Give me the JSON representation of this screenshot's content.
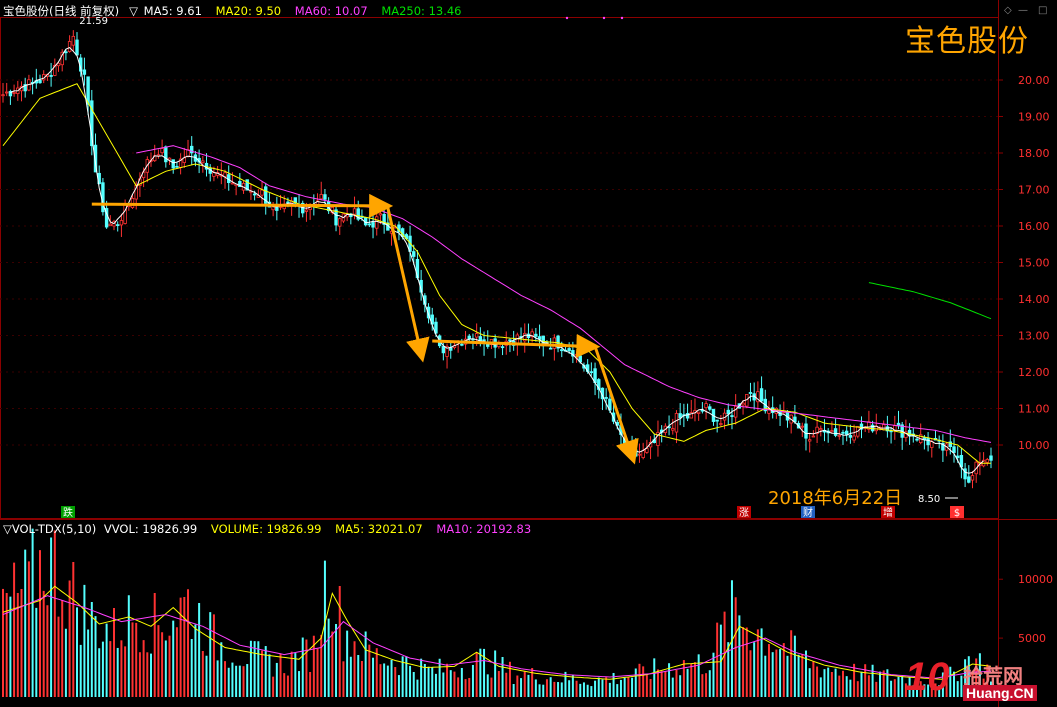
{
  "header": {
    "stock_name": "宝色股份(日线 前复权)",
    "ma_labels": [
      {
        "text": "MA5: 9.61",
        "color": "#ffffff"
      },
      {
        "text": "MA20: 9.50",
        "color": "#ffff00"
      },
      {
        "text": "MA60: 10.07",
        "color": "#ff40ff"
      },
      {
        "text": "MA250: 13.46",
        "color": "#00e000"
      }
    ],
    "title_overlay": "宝色股份",
    "date_annotation": "2018年6月22日"
  },
  "volume_header": {
    "indicator": "▽VOL-TDX(5,10)",
    "labels": [
      {
        "text": "VVOL: 19826.99",
        "color": "#ffffff"
      },
      {
        "text": "VOLUME: 19826.99",
        "color": "#ffff00"
      },
      {
        "text": "MA5: 32021.07",
        "color": "#ffff00"
      },
      {
        "text": "MA10: 20192.83",
        "color": "#ff40ff"
      }
    ]
  },
  "markers": {
    "high_label": "21.59",
    "low_label": "8.50",
    "event_badges": [
      {
        "text": "跌",
        "color": "#00a000"
      },
      {
        "text": "涨",
        "color": "#c00000"
      },
      {
        "text": "财",
        "color": "#2060c0"
      },
      {
        "text": "增",
        "color": "#c00000"
      },
      {
        "text": "$",
        "color": "#ff3030"
      }
    ]
  },
  "logo": {
    "brand": "10",
    "cn": "拾荒网",
    "url": "Huang.CN"
  },
  "colors": {
    "up": "#ff3232",
    "down": "#54ffff",
    "ma5": "#ffffff",
    "ma20": "#ffff00",
    "ma60": "#ff40ff",
    "ma250": "#00e000",
    "arrow": "#ffa500",
    "grid": "#8b0000"
  },
  "chart_data": [
    {
      "type": "candlestick",
      "title": "宝色股份(日线 前复权)",
      "y_ticks": [
        "20.00",
        "19.00",
        "18.00",
        "17.00",
        "16.00",
        "15.00",
        "14.00",
        "13.00",
        "12.00",
        "11.00",
        "10.00"
      ],
      "ylim": [
        8.2,
        21.9
      ],
      "close_path": [
        [
          0,
          19.6
        ],
        [
          4,
          19.8
        ],
        [
          8,
          19.9
        ],
        [
          12,
          20.1
        ],
        [
          16,
          20.7
        ],
        [
          19,
          21.2
        ],
        [
          22,
          20.0
        ],
        [
          25,
          17.5
        ],
        [
          28,
          16.0
        ],
        [
          31,
          16.1
        ],
        [
          34,
          16.6
        ],
        [
          38,
          17.6
        ],
        [
          42,
          18.1
        ],
        [
          46,
          17.6
        ],
        [
          50,
          18.0
        ],
        [
          54,
          17.8
        ],
        [
          58,
          17.4
        ],
        [
          62,
          17.2
        ],
        [
          66,
          17.0
        ],
        [
          70,
          16.9
        ],
        [
          74,
          16.3
        ],
        [
          78,
          16.6
        ],
        [
          82,
          16.5
        ],
        [
          86,
          16.8
        ],
        [
          90,
          16.2
        ],
        [
          94,
          16.4
        ],
        [
          98,
          16.0
        ],
        [
          102,
          16.2
        ],
        [
          106,
          15.9
        ],
        [
          110,
          15.4
        ],
        [
          114,
          14.0
        ],
        [
          118,
          12.6
        ],
        [
          122,
          12.8
        ],
        [
          126,
          13.0
        ],
        [
          130,
          12.9
        ],
        [
          134,
          12.8
        ],
        [
          138,
          12.9
        ],
        [
          142,
          13.0
        ],
        [
          146,
          12.8
        ],
        [
          150,
          12.8
        ],
        [
          154,
          12.6
        ],
        [
          158,
          12.0
        ],
        [
          162,
          11.4
        ],
        [
          166,
          10.4
        ],
        [
          170,
          9.7
        ],
        [
          174,
          9.8
        ],
        [
          178,
          10.3
        ],
        [
          182,
          10.7
        ],
        [
          186,
          10.8
        ],
        [
          190,
          11.0
        ],
        [
          194,
          10.6
        ],
        [
          198,
          11.0
        ],
        [
          202,
          11.5
        ],
        [
          206,
          11.1
        ],
        [
          210,
          10.9
        ],
        [
          214,
          10.6
        ],
        [
          218,
          10.2
        ],
        [
          222,
          10.5
        ],
        [
          226,
          10.3
        ],
        [
          230,
          10.4
        ],
        [
          234,
          10.5
        ],
        [
          238,
          10.6
        ],
        [
          242,
          10.4
        ],
        [
          246,
          10.3
        ],
        [
          250,
          10.1
        ],
        [
          254,
          9.9
        ],
        [
          258,
          9.8
        ],
        [
          261,
          8.9
        ],
        [
          264,
          9.6
        ],
        [
          267,
          9.7
        ]
      ],
      "ma_series": [
        {
          "name": "MA20",
          "key": "ma20",
          "points": [
            [
              0,
              18.2
            ],
            [
              10,
              19.5
            ],
            [
              20,
              19.9
            ],
            [
              28,
              18.5
            ],
            [
              36,
              17.1
            ],
            [
              44,
              17.5
            ],
            [
              52,
              17.7
            ],
            [
              60,
              17.5
            ],
            [
              70,
              17.0
            ],
            [
              80,
              16.6
            ],
            [
              90,
              16.4
            ],
            [
              100,
              16.2
            ],
            [
              106,
              16.0
            ],
            [
              112,
              15.3
            ],
            [
              118,
              14.1
            ],
            [
              124,
              13.3
            ],
            [
              130,
              13.0
            ],
            [
              140,
              12.9
            ],
            [
              150,
              12.8
            ],
            [
              158,
              12.6
            ],
            [
              164,
              12.0
            ],
            [
              170,
              11.0
            ],
            [
              176,
              10.3
            ],
            [
              184,
              10.1
            ],
            [
              190,
              10.4
            ],
            [
              198,
              10.6
            ],
            [
              206,
              11.0
            ],
            [
              214,
              10.9
            ],
            [
              222,
              10.6
            ],
            [
              230,
              10.5
            ],
            [
              240,
              10.4
            ],
            [
              250,
              10.2
            ],
            [
              258,
              10.0
            ],
            [
              264,
              9.5
            ],
            [
              267,
              9.5
            ]
          ]
        },
        {
          "name": "MA60",
          "key": "ma60",
          "points": [
            [
              36,
              18.0
            ],
            [
              46,
              18.2
            ],
            [
              56,
              17.9
            ],
            [
              64,
              17.6
            ],
            [
              72,
              17.1
            ],
            [
              82,
              16.8
            ],
            [
              92,
              16.6
            ],
            [
              100,
              16.5
            ],
            [
              108,
              16.2
            ],
            [
              116,
              15.7
            ],
            [
              124,
              15.1
            ],
            [
              132,
              14.6
            ],
            [
              140,
              14.1
            ],
            [
              148,
              13.7
            ],
            [
              156,
              13.2
            ],
            [
              162,
              12.7
            ],
            [
              168,
              12.2
            ],
            [
              174,
              11.9
            ],
            [
              180,
              11.6
            ],
            [
              188,
              11.3
            ],
            [
              196,
              11.1
            ],
            [
              204,
              11.0
            ],
            [
              212,
              10.9
            ],
            [
              220,
              10.8
            ],
            [
              228,
              10.7
            ],
            [
              236,
              10.6
            ],
            [
              244,
              10.5
            ],
            [
              252,
              10.4
            ],
            [
              260,
              10.2
            ],
            [
              267,
              10.07
            ]
          ]
        },
        {
          "name": "MA250",
          "key": "ma250",
          "points": [
            [
              234,
              14.45
            ],
            [
              246,
              14.2
            ],
            [
              256,
              13.9
            ],
            [
              267,
              13.46
            ]
          ]
        }
      ],
      "trend_arrows": [
        {
          "from": [
            24,
            16.6
          ],
          "to": [
            103,
            16.55
          ]
        },
        {
          "from": [
            104,
            16.5
          ],
          "to": [
            113,
            12.5
          ]
        },
        {
          "from": [
            116,
            12.85
          ],
          "to": [
            159,
            12.7
          ]
        },
        {
          "from": [
            160,
            12.7
          ],
          "to": [
            170,
            9.7
          ]
        }
      ]
    },
    {
      "type": "bar",
      "title": "VOL-TDX(5,10)",
      "y_ticks": [
        "10000",
        "5000"
      ],
      "ylim": [
        0,
        13500
      ],
      "volume_profile": [
        [
          0,
          7500
        ],
        [
          6,
          9000
        ],
        [
          12,
          12000
        ],
        [
          18,
          9000
        ],
        [
          24,
          6500
        ],
        [
          30,
          5500
        ],
        [
          36,
          7000
        ],
        [
          42,
          6000
        ],
        [
          50,
          8000
        ],
        [
          58,
          4500
        ],
        [
          66,
          3500
        ],
        [
          76,
          2800
        ],
        [
          84,
          4000
        ],
        [
          88,
          11000
        ],
        [
          92,
          5500
        ],
        [
          100,
          3500
        ],
        [
          108,
          3000
        ],
        [
          116,
          2200
        ],
        [
          124,
          2600
        ],
        [
          130,
          3200
        ],
        [
          138,
          2000
        ],
        [
          150,
          1600
        ],
        [
          160,
          1400
        ],
        [
          170,
          1800
        ],
        [
          180,
          2600
        ],
        [
          190,
          2900
        ],
        [
          198,
          7500
        ],
        [
          202,
          6000
        ],
        [
          210,
          4500
        ],
        [
          220,
          2600
        ],
        [
          232,
          2000
        ],
        [
          244,
          1600
        ],
        [
          255,
          1500
        ],
        [
          262,
          3500
        ],
        [
          267,
          2000
        ]
      ],
      "ma_series": [
        {
          "name": "MA5",
          "key": "ma20",
          "points": [
            [
              0,
              7200
            ],
            [
              10,
              8200
            ],
            [
              14,
              9400
            ],
            [
              20,
              8000
            ],
            [
              26,
              6200
            ],
            [
              34,
              6800
            ],
            [
              40,
              6000
            ],
            [
              46,
              7600
            ],
            [
              52,
              5800
            ],
            [
              60,
              4200
            ],
            [
              70,
              3600
            ],
            [
              80,
              3200
            ],
            [
              86,
              5000
            ],
            [
              89,
              8800
            ],
            [
              93,
              6500
            ],
            [
              98,
              4000
            ],
            [
              106,
              3100
            ],
            [
              114,
              2500
            ],
            [
              122,
              2600
            ],
            [
              128,
              3800
            ],
            [
              134,
              2600
            ],
            [
              144,
              2000
            ],
            [
              154,
              1700
            ],
            [
              164,
              1500
            ],
            [
              174,
              1900
            ],
            [
              184,
              2800
            ],
            [
              194,
              3000
            ],
            [
              199,
              6000
            ],
            [
              204,
              5200
            ],
            [
              212,
              3800
            ],
            [
              222,
              2700
            ],
            [
              232,
              2100
            ],
            [
              244,
              1700
            ],
            [
              254,
              1500
            ],
            [
              262,
              2800
            ],
            [
              267,
              2600
            ]
          ]
        },
        {
          "name": "MA10",
          "key": "ma60",
          "points": [
            [
              0,
              7000
            ],
            [
              12,
              8600
            ],
            [
              22,
              7600
            ],
            [
              32,
              6400
            ],
            [
              44,
              7000
            ],
            [
              54,
              6000
            ],
            [
              64,
              4400
            ],
            [
              76,
              3600
            ],
            [
              86,
              4200
            ],
            [
              92,
              6400
            ],
            [
              100,
              4600
            ],
            [
              110,
              3300
            ],
            [
              120,
              2700
            ],
            [
              130,
              3100
            ],
            [
              140,
              2400
            ],
            [
              152,
              1900
            ],
            [
              164,
              1700
            ],
            [
              176,
              2000
            ],
            [
              188,
              2700
            ],
            [
              198,
              4200
            ],
            [
              206,
              5000
            ],
            [
              214,
              3800
            ],
            [
              226,
              2700
            ],
            [
              240,
              1900
            ],
            [
              252,
              1600
            ],
            [
              262,
              2100
            ],
            [
              267,
              2200
            ]
          ]
        }
      ]
    }
  ]
}
